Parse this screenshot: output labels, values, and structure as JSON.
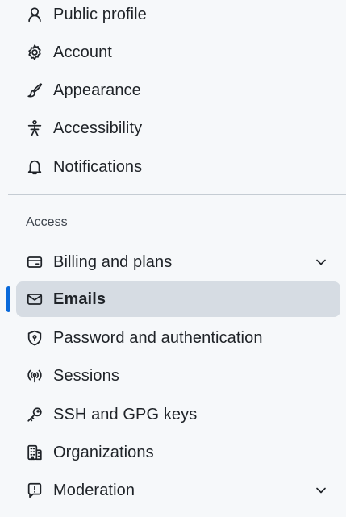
{
  "colors": {
    "active_marker": "#0969da",
    "active_background": "#d0d7de",
    "divider": "#c5ccd3"
  },
  "top_items": [
    {
      "label": "Public profile",
      "icon": "person-icon"
    },
    {
      "label": "Account",
      "icon": "gear-icon"
    },
    {
      "label": "Appearance",
      "icon": "paintbrush-icon"
    },
    {
      "label": "Accessibility",
      "icon": "accessibility-icon"
    },
    {
      "label": "Notifications",
      "icon": "bell-icon"
    }
  ],
  "access_group": {
    "heading": "Access",
    "items": [
      {
        "label": "Billing and plans",
        "icon": "credit-card-icon",
        "expandable": true
      },
      {
        "label": "Emails",
        "icon": "mail-icon",
        "active": true
      },
      {
        "label": "Password and authentication",
        "icon": "shield-lock-icon"
      },
      {
        "label": "Sessions",
        "icon": "broadcast-icon"
      },
      {
        "label": "SSH and GPG keys",
        "icon": "key-icon"
      },
      {
        "label": "Organizations",
        "icon": "organization-icon"
      },
      {
        "label": "Moderation",
        "icon": "report-icon",
        "expandable": true
      }
    ]
  }
}
